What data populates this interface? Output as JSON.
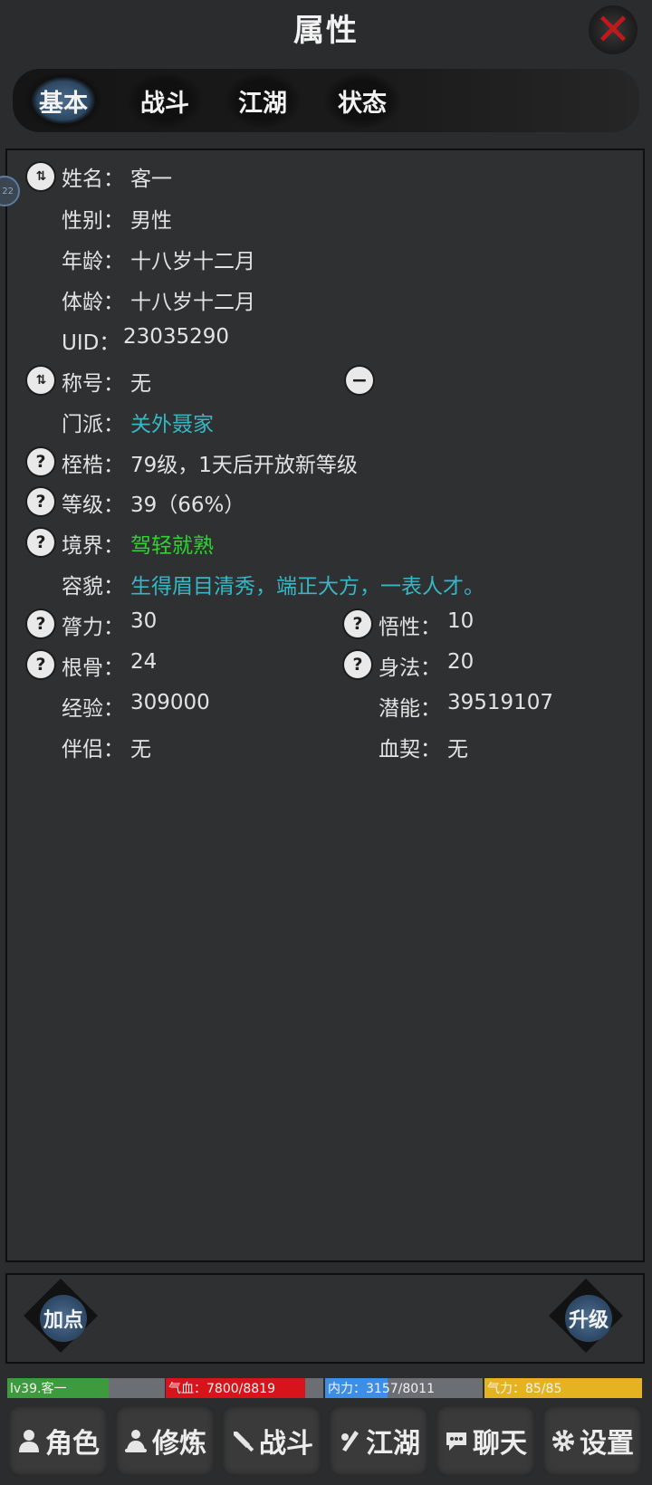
{
  "header": {
    "title": "属性"
  },
  "tabs": [
    "基本",
    "战斗",
    "江湖",
    "状态"
  ],
  "side_badge": "22",
  "info": {
    "name_label": "姓名：",
    "name": "客一",
    "gender_label": "性别：",
    "gender": "男性",
    "age_label": "年龄：",
    "age": "十八岁十二月",
    "body_age_label": "体龄：",
    "body_age": "十八岁十二月",
    "uid_label": "UID：",
    "uid": "23035290",
    "title_label": "称号：",
    "title": "无",
    "sect_label": "门派：",
    "sect": "关外聂家",
    "shackle_label": "桎梏：",
    "shackle": "79级，1天后开放新等级",
    "level_label": "等级：",
    "level": "39（66%）",
    "realm_label": "境界：",
    "realm": "驾轻就熟",
    "look_label": "容貌：",
    "look": "生得眉目清秀，端正大方，一表人才。",
    "strength_label": "膂力：",
    "strength": "30",
    "wisdom_label": "悟性：",
    "wisdom": "10",
    "bone_label": "根骨：",
    "bone": "24",
    "agility_label": "身法：",
    "agility": "20",
    "exp_label": "经验：",
    "exp": "309000",
    "potential_label": "潜能：",
    "potential": "39519107",
    "partner_label": "伴侣：",
    "partner": "无",
    "blood_label": "血契：",
    "blood": "无"
  },
  "buttons": {
    "add_points": "加点",
    "upgrade": "升级"
  },
  "status": {
    "name": "lv39.客一",
    "hp": "气血：7800/8819",
    "hp_fill": 0.884,
    "mp": "内力：3157/8011",
    "mp_fill": 0.394,
    "qi": "气力：85/85",
    "qi_fill": 1.0
  },
  "nav": [
    "角色",
    "修炼",
    "战斗",
    "江湖",
    "聊天",
    "设置"
  ],
  "colors": {
    "hp": "#d8141b",
    "mp": "#3d8ee6",
    "qi": "#e5b31f",
    "name": "#3d9a3d",
    "tab_active": "#3e5f82"
  }
}
